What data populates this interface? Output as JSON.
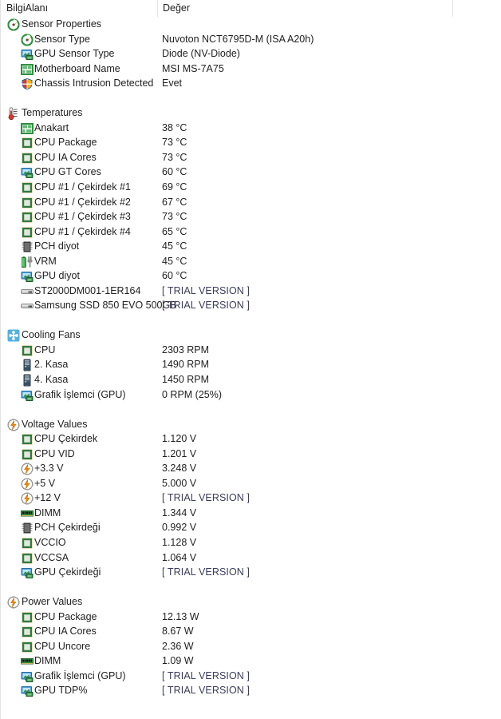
{
  "header": {
    "col_info": "BilgiAlanı",
    "col_value": "Değer"
  },
  "sections": [
    {
      "id": "sensor-properties",
      "title": "Sensor Properties",
      "icon": "sensor-gauge-icon",
      "rows": [
        {
          "label": "Sensor Type",
          "value": "Nuvoton NCT6795D-M  (ISA A20h)",
          "icon": "sensor-gauge-icon"
        },
        {
          "label": "GPU Sensor Type",
          "value": "Diode  (NV-Diode)",
          "icon": "gpu-monitor-icon"
        },
        {
          "label": "Motherboard Name",
          "value": "MSI MS-7A75",
          "icon": "motherboard-icon"
        },
        {
          "label": "Chassis Intrusion Detected",
          "value": "Evet",
          "icon": "shield-icon"
        }
      ]
    },
    {
      "id": "temperatures",
      "title": "Temperatures",
      "icon": "thermometer-icon",
      "rows": [
        {
          "label": "Anakart",
          "value": "38 °C",
          "icon": "motherboard-icon"
        },
        {
          "label": "CPU Package",
          "value": "73 °C",
          "icon": "cpu-icon"
        },
        {
          "label": "CPU IA Cores",
          "value": "73 °C",
          "icon": "cpu-icon"
        },
        {
          "label": "CPU GT Cores",
          "value": "60 °C",
          "icon": "gpu-monitor-icon"
        },
        {
          "label": "CPU #1 / Çekirdek #1",
          "value": "69 °C",
          "icon": "cpu-icon"
        },
        {
          "label": "CPU #1 / Çekirdek #2",
          "value": "67 °C",
          "icon": "cpu-icon"
        },
        {
          "label": "CPU #1 / Çekirdek #3",
          "value": "73 °C",
          "icon": "cpu-icon"
        },
        {
          "label": "CPU #1 / Çekirdek #4",
          "value": "65 °C",
          "icon": "cpu-icon"
        },
        {
          "label": "PCH diyot",
          "value": "45 °C",
          "icon": "chip-icon"
        },
        {
          "label": "VRM",
          "value": "45 °C",
          "icon": "vrm-battery-icon"
        },
        {
          "label": "GPU diyot",
          "value": "60 °C",
          "icon": "gpu-monitor-icon"
        },
        {
          "label": "ST2000DM001-1ER164",
          "value": "[ TRIAL VERSION ]",
          "icon": "drive-icon",
          "trial": true
        },
        {
          "label": "Samsung SSD 850 EVO 500GB",
          "value": "[ TRIAL VERSION ]",
          "icon": "drive-icon",
          "trial": true
        }
      ]
    },
    {
      "id": "cooling-fans",
      "title": "Cooling Fans",
      "icon": "fan-icon",
      "rows": [
        {
          "label": "CPU",
          "value": "2303 RPM",
          "icon": "cpu-icon"
        },
        {
          "label": "2. Kasa",
          "value": "1490 RPM",
          "icon": "case-tower-icon"
        },
        {
          "label": "4. Kasa",
          "value": "1450 RPM",
          "icon": "case-tower-icon"
        },
        {
          "label": "Grafik İşlemci (GPU)",
          "value": "0 RPM  (25%)",
          "icon": "gpu-monitor-icon"
        }
      ]
    },
    {
      "id": "voltage-values",
      "title": "Voltage Values",
      "icon": "bolt-icon",
      "rows": [
        {
          "label": "CPU Çekirdek",
          "value": "1.120 V",
          "icon": "cpu-icon"
        },
        {
          "label": "CPU VID",
          "value": "1.201 V",
          "icon": "cpu-icon"
        },
        {
          "label": "+3.3 V",
          "value": "3.248 V",
          "icon": "bolt-icon"
        },
        {
          "label": "+5 V",
          "value": "5.000 V",
          "icon": "bolt-icon"
        },
        {
          "label": "+12 V",
          "value": "[ TRIAL VERSION ]",
          "icon": "bolt-icon",
          "trial": true
        },
        {
          "label": "DIMM",
          "value": "1.344 V",
          "icon": "dimm-icon"
        },
        {
          "label": "PCH Çekirdeği",
          "value": "0.992 V",
          "icon": "chip-icon"
        },
        {
          "label": "VCCIO",
          "value": "1.128 V",
          "icon": "cpu-icon"
        },
        {
          "label": "VCCSA",
          "value": "1.064 V",
          "icon": "cpu-icon"
        },
        {
          "label": "GPU Çekirdeği",
          "value": "[ TRIAL VERSION ]",
          "icon": "gpu-monitor-icon",
          "trial": true
        }
      ]
    },
    {
      "id": "power-values",
      "title": "Power Values",
      "icon": "bolt-icon",
      "rows": [
        {
          "label": "CPU Package",
          "value": "12.13 W",
          "icon": "cpu-icon"
        },
        {
          "label": "CPU IA Cores",
          "value": "8.67 W",
          "icon": "cpu-icon"
        },
        {
          "label": "CPU Uncore",
          "value": "2.36 W",
          "icon": "cpu-icon"
        },
        {
          "label": "DIMM",
          "value": "1.09 W",
          "icon": "dimm-icon"
        },
        {
          "label": "Grafik İşlemci (GPU)",
          "value": "[ TRIAL VERSION ]",
          "icon": "gpu-monitor-icon",
          "trial": true
        },
        {
          "label": "GPU TDP%",
          "value": "[ TRIAL VERSION ]",
          "icon": "gpu-monitor-icon",
          "trial": true
        }
      ]
    }
  ],
  "colors": {
    "text": "#212121",
    "grid_line": "#e6e6e6",
    "green_chip": "#2e7d4f",
    "orange_bolt": "#e8840a",
    "blue_fan": "#3a9fd8"
  }
}
